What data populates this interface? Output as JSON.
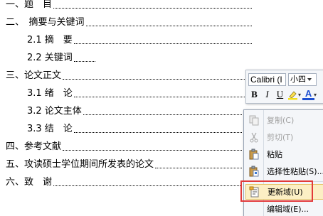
{
  "toc": [
    {
      "text": "一、题　目"
    },
    {
      "text": "二、　摘要与关键词"
    },
    {
      "text": "2.1 摘　要"
    },
    {
      "text": "2.2 关键词"
    },
    {
      "text": "三、论文正文"
    },
    {
      "text": "3.1 绪　论"
    },
    {
      "text": "3.2 论文主体"
    },
    {
      "text": "3.3 结　论"
    },
    {
      "text": "四、参考文献"
    },
    {
      "text": "五、攻读硕士学位期间所发表的论文"
    },
    {
      "text": "六、致　谢"
    }
  ],
  "mini_toolbar": {
    "font_name": "Calibri (I",
    "font_size": "小四",
    "bold": "B",
    "italic": "I",
    "underline": "U",
    "font_color": "A"
  },
  "context_menu": {
    "items": [
      {
        "label": "复制(C)",
        "icon": "copy-icon",
        "disabled": true
      },
      {
        "label": "剪切(T)",
        "icon": "cut-icon",
        "disabled": true
      },
      {
        "label": "粘贴",
        "icon": "paste-icon",
        "disabled": false
      },
      {
        "label": "选择性粘贴(S)...",
        "icon": "paste-special-icon",
        "disabled": false
      },
      {
        "label": "更新域(U)",
        "icon": "update-field-icon",
        "disabled": false
      },
      {
        "label": "编辑域(E)...",
        "icon": "edit-field-icon",
        "disabled": false
      }
    ]
  },
  "colors": {
    "highlight_box": "#e23a3a",
    "menu_hover": "#fcefc4",
    "font_color": "#1d4fd1"
  }
}
